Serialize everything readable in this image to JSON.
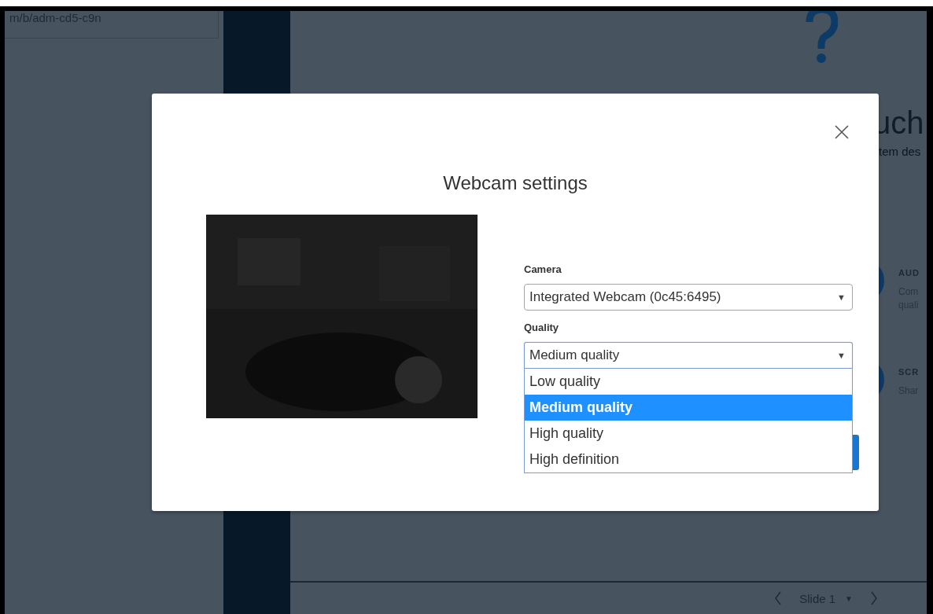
{
  "background": {
    "address": "m/b/adm-cd5-c9n",
    "heading": "uch",
    "subheading": "tem des",
    "features": [
      {
        "title": "AUD",
        "lines": [
          "Com",
          "quali"
        ]
      },
      {
        "title": "SCR",
        "lines": [
          "Shar"
        ]
      }
    ],
    "slide_nav": {
      "label": "Slide 1",
      "caret": "▼"
    }
  },
  "dialog": {
    "title": "Webcam settings",
    "fields": [
      {
        "label": "Camera",
        "value": "Integrated Webcam (0c45:6495)",
        "open": false,
        "caret": "▼"
      },
      {
        "label": "Quality",
        "value": "Medium quality",
        "open": true,
        "caret": "▼",
        "options": [
          {
            "label": "Low quality",
            "selected": false
          },
          {
            "label": "Medium quality",
            "selected": true
          },
          {
            "label": "High quality",
            "selected": false
          },
          {
            "label": "High definition",
            "selected": false
          }
        ]
      }
    ]
  }
}
